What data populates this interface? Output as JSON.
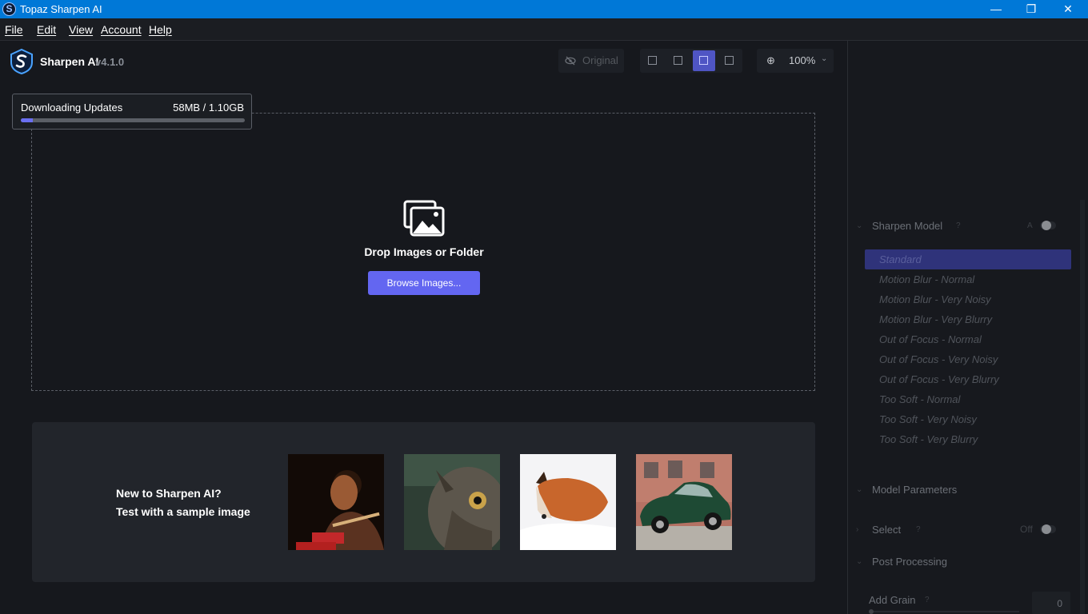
{
  "window": {
    "title": "Topaz Sharpen AI",
    "logo_letter": "S",
    "controls": {
      "minimize": "—",
      "maximize": "❐",
      "close": "✕"
    }
  },
  "menu": [
    "File",
    "Edit",
    "View",
    "Account",
    "Help"
  ],
  "header": {
    "app_name": "Sharpen AI",
    "version": "v4.1.0",
    "original_label": "Original",
    "zoom_label": "100%",
    "zoom_icon": "zoom-in-icon",
    "view_modes": [
      "single-view",
      "split-view",
      "side-by-side-view",
      "grid-view"
    ],
    "active_view_mode": "side-by-side-view"
  },
  "download": {
    "label": "Downloading Updates",
    "size": "58MB / 1.10GB",
    "progress": 0.053
  },
  "dropzone": {
    "text": "Drop Images or Folder",
    "button": "Browse Images..."
  },
  "samples": {
    "title": "New to Sharpen AI?",
    "subtitle": "Test with a sample image",
    "thumbnails": [
      "woman-sewing",
      "owl",
      "fox-in-snow",
      "vintage-green-car"
    ]
  },
  "right_panel": {
    "sharpen_model": {
      "label": "Sharpen Model",
      "auto_label": "A",
      "models": [
        "Standard",
        "Motion Blur - Normal",
        "Motion Blur - Very Noisy",
        "Motion Blur - Very Blurry",
        "Out of Focus - Normal",
        "Out of Focus - Very Noisy",
        "Out of Focus - Very Blurry",
        "Too Soft - Normal",
        "Too Soft - Very Noisy",
        "Too Soft - Very Blurry"
      ],
      "selected_index": 0
    },
    "model_parameters": {
      "label": "Model Parameters"
    },
    "select": {
      "label": "Select",
      "state": "Off"
    },
    "post_processing": {
      "label": "Post Processing"
    },
    "add_grain": {
      "label": "Add Grain",
      "value": "0"
    }
  },
  "colors": {
    "accent": "#6366f1",
    "titlebar": "#0078d7",
    "background": "#16181d",
    "selected_model": "#2f337a"
  }
}
